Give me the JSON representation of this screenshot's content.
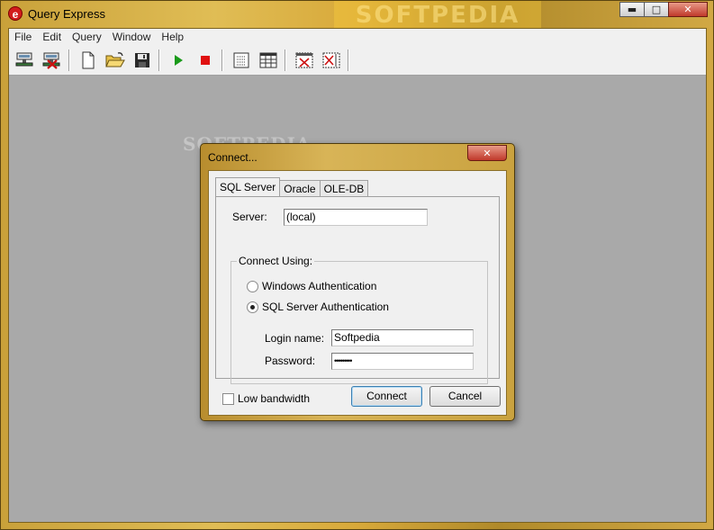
{
  "window": {
    "title": "Query Express",
    "banner": "SOFTPEDIA",
    "app_icon": "e",
    "minimize": "▬",
    "maximize": "□",
    "close": "✕"
  },
  "menu": [
    "File",
    "Edit",
    "Query",
    "Window",
    "Help"
  ],
  "toolbar": {
    "icons": [
      "connect-icon",
      "disconnect-icon",
      "new-file-icon",
      "open-folder-icon",
      "save-icon",
      "run-icon",
      "stop-icon",
      "results-text-icon",
      "results-grid-icon",
      "hide-results-icon",
      "hide-browser-icon"
    ],
    "colors": {
      "run": "#1a9a1a",
      "stop": "#e01010",
      "x": "#cc1111"
    }
  },
  "watermark": "SOFTPEDIA",
  "dialog": {
    "title": "Connect...",
    "close": "✕",
    "tabs": [
      "SQL Server",
      "Oracle",
      "OLE-DB"
    ],
    "active_tab": "SQL Server",
    "server_label": "Server:",
    "server_value": "(local)",
    "group_label": "Connect Using:",
    "auth_options": [
      "Windows Authentication",
      "SQL Server Authentication"
    ],
    "selected_auth": "SQL Server Authentication",
    "login_label": "Login name:",
    "login_value": "Softpedia",
    "password_label": "Password:",
    "password_value": "•••••••••",
    "low_bandwidth_label": "Low bandwidth",
    "low_bandwidth_checked": false,
    "connect_button": "Connect",
    "cancel_button": "Cancel"
  }
}
